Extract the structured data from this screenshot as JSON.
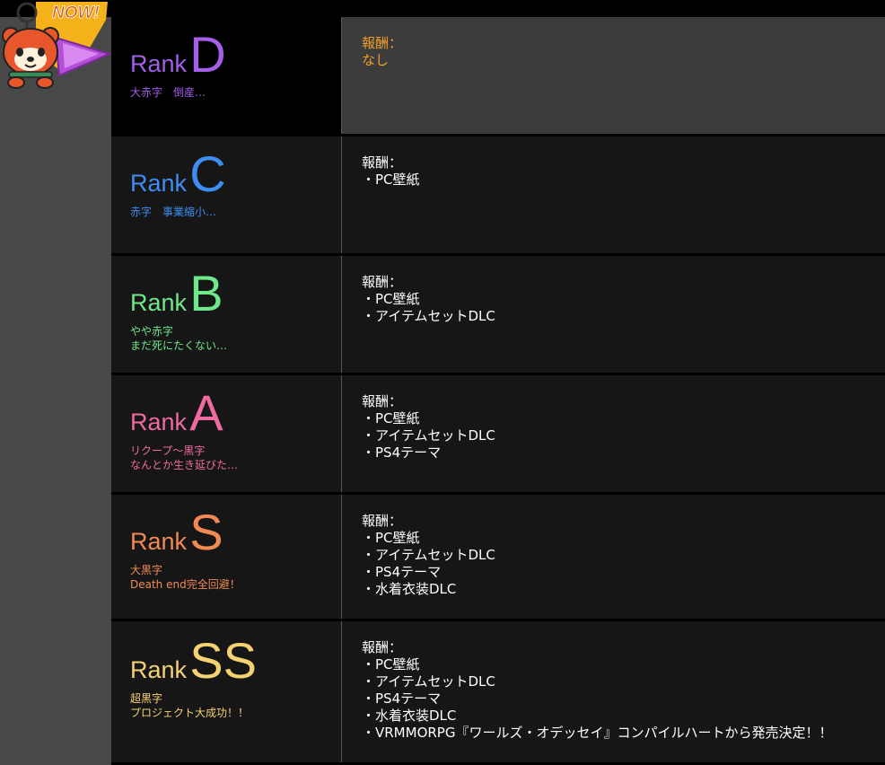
{
  "badge": {
    "label": "NOW!"
  },
  "reward_label": "報酬：",
  "ranks": [
    {
      "id": "d",
      "rank_word": "Rank",
      "rank_letter": "D",
      "desc": [
        "大赤字　倒産…"
      ],
      "rewards": [
        "なし"
      ],
      "color": "#a35fe8",
      "reward_color": "#f0a02a",
      "current": true
    },
    {
      "id": "c",
      "rank_word": "Rank",
      "rank_letter": "C",
      "desc": [
        "赤字　事業縮小…"
      ],
      "rewards": [
        "・PC壁紙"
      ],
      "color": "#3d8ef0"
    },
    {
      "id": "b",
      "rank_word": "Rank",
      "rank_letter": "B",
      "desc": [
        "やや赤字",
        "まだ死にたくない…"
      ],
      "rewards": [
        "・PC壁紙",
        "・アイテムセットDLC"
      ],
      "color": "#6fe88b"
    },
    {
      "id": "a",
      "rank_word": "Rank",
      "rank_letter": "A",
      "desc": [
        "リクープ～黒字",
        "なんとか生き延びた…"
      ],
      "rewards": [
        "・PC壁紙",
        "・アイテムセットDLC",
        "・PS4テーマ"
      ],
      "color": "#ef6a9e"
    },
    {
      "id": "s",
      "rank_word": "Rank",
      "rank_letter": "S",
      "desc": [
        "大黒字",
        "Death end完全回避！"
      ],
      "rewards": [
        "・PC壁紙",
        "・アイテムセットDLC",
        "・PS4テーマ",
        "・水着衣装DLC"
      ],
      "color": "#f08a55"
    },
    {
      "id": "ss",
      "rank_word": "Rank",
      "rank_letter": "SS",
      "desc": [
        "超黒字",
        "プロジェクト大成功！！"
      ],
      "rewards": [
        "・PC壁紙",
        "・アイテムセットDLC",
        "・PS4テーマ",
        "・水着衣装DLC",
        "・VRMMORPG『ワールズ・オデッセイ』コンパイルハートから発売決定！！"
      ],
      "color": "#f5d271"
    }
  ]
}
